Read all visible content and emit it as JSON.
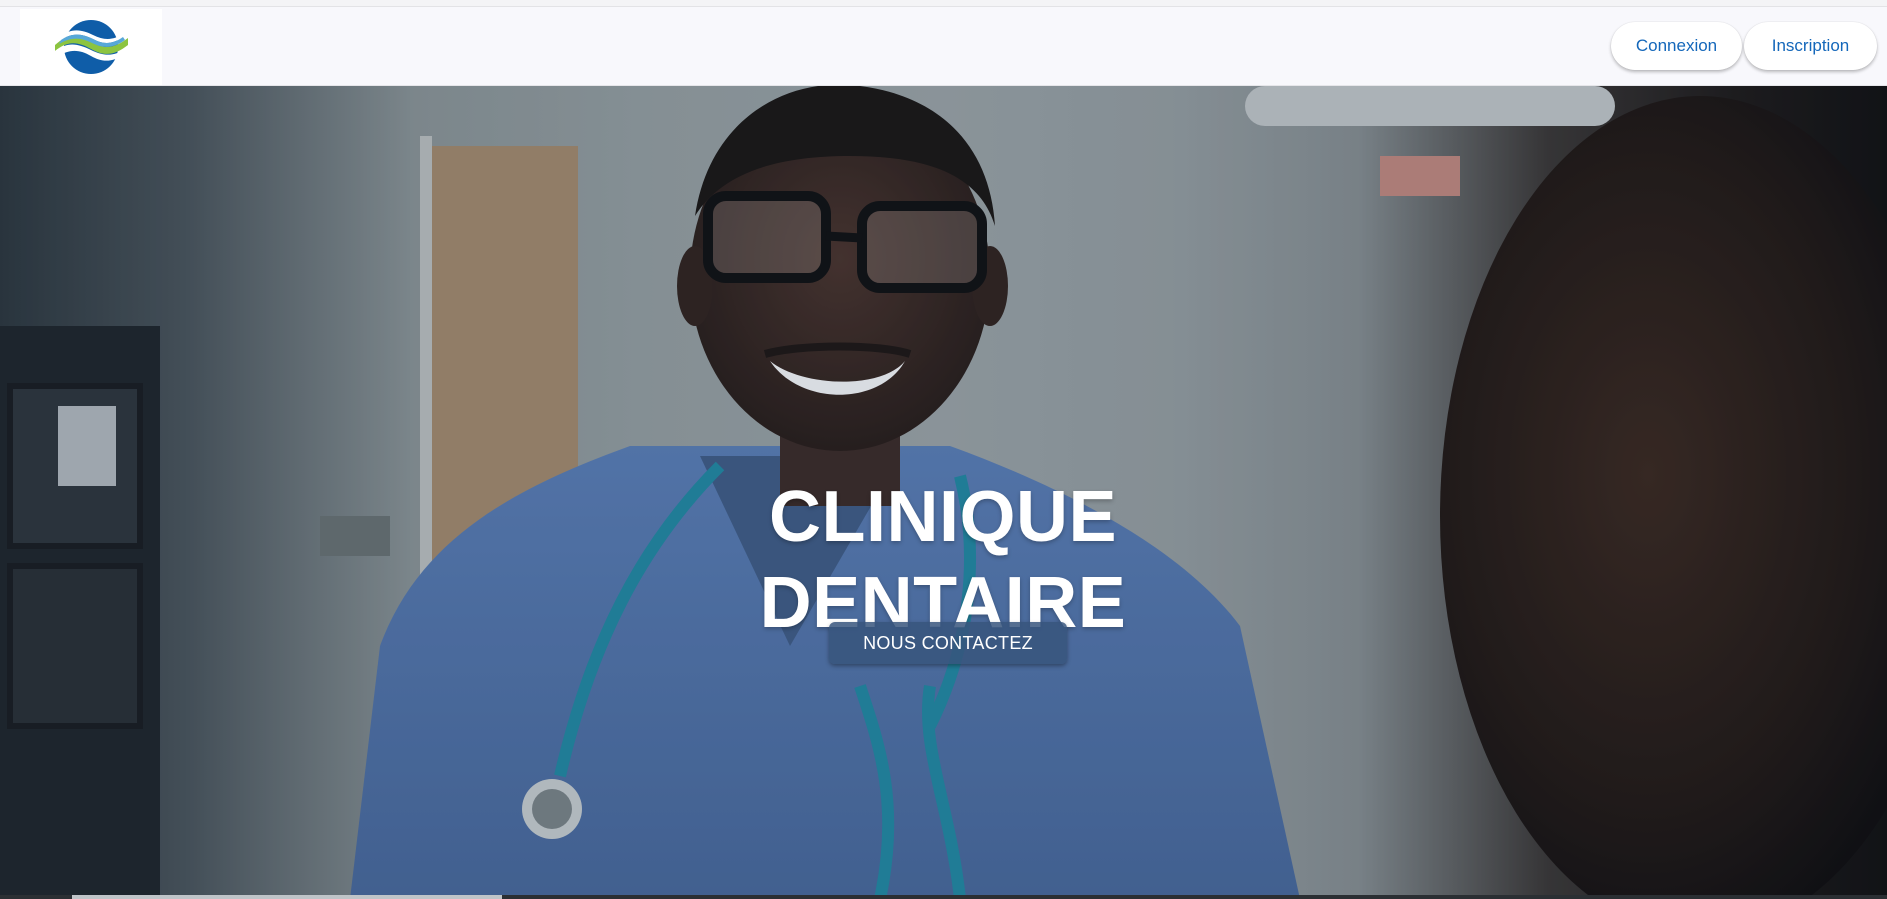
{
  "navbar": {
    "logo_icon": "wave-globe-logo",
    "login_label": "Connexion",
    "signup_label": "Inscription"
  },
  "hero": {
    "title_line1": "CLINIQUE",
    "title_line2": "DENTAIRE",
    "cta_label": "NOUS CONTACTEZ",
    "background": "photo-doctor-smiling-with-stethoscope"
  },
  "colors": {
    "brand_blue": "#1467ba",
    "logo_blue": "#0f5da8",
    "logo_green": "#8cc440",
    "cta_background": "#37557d"
  }
}
